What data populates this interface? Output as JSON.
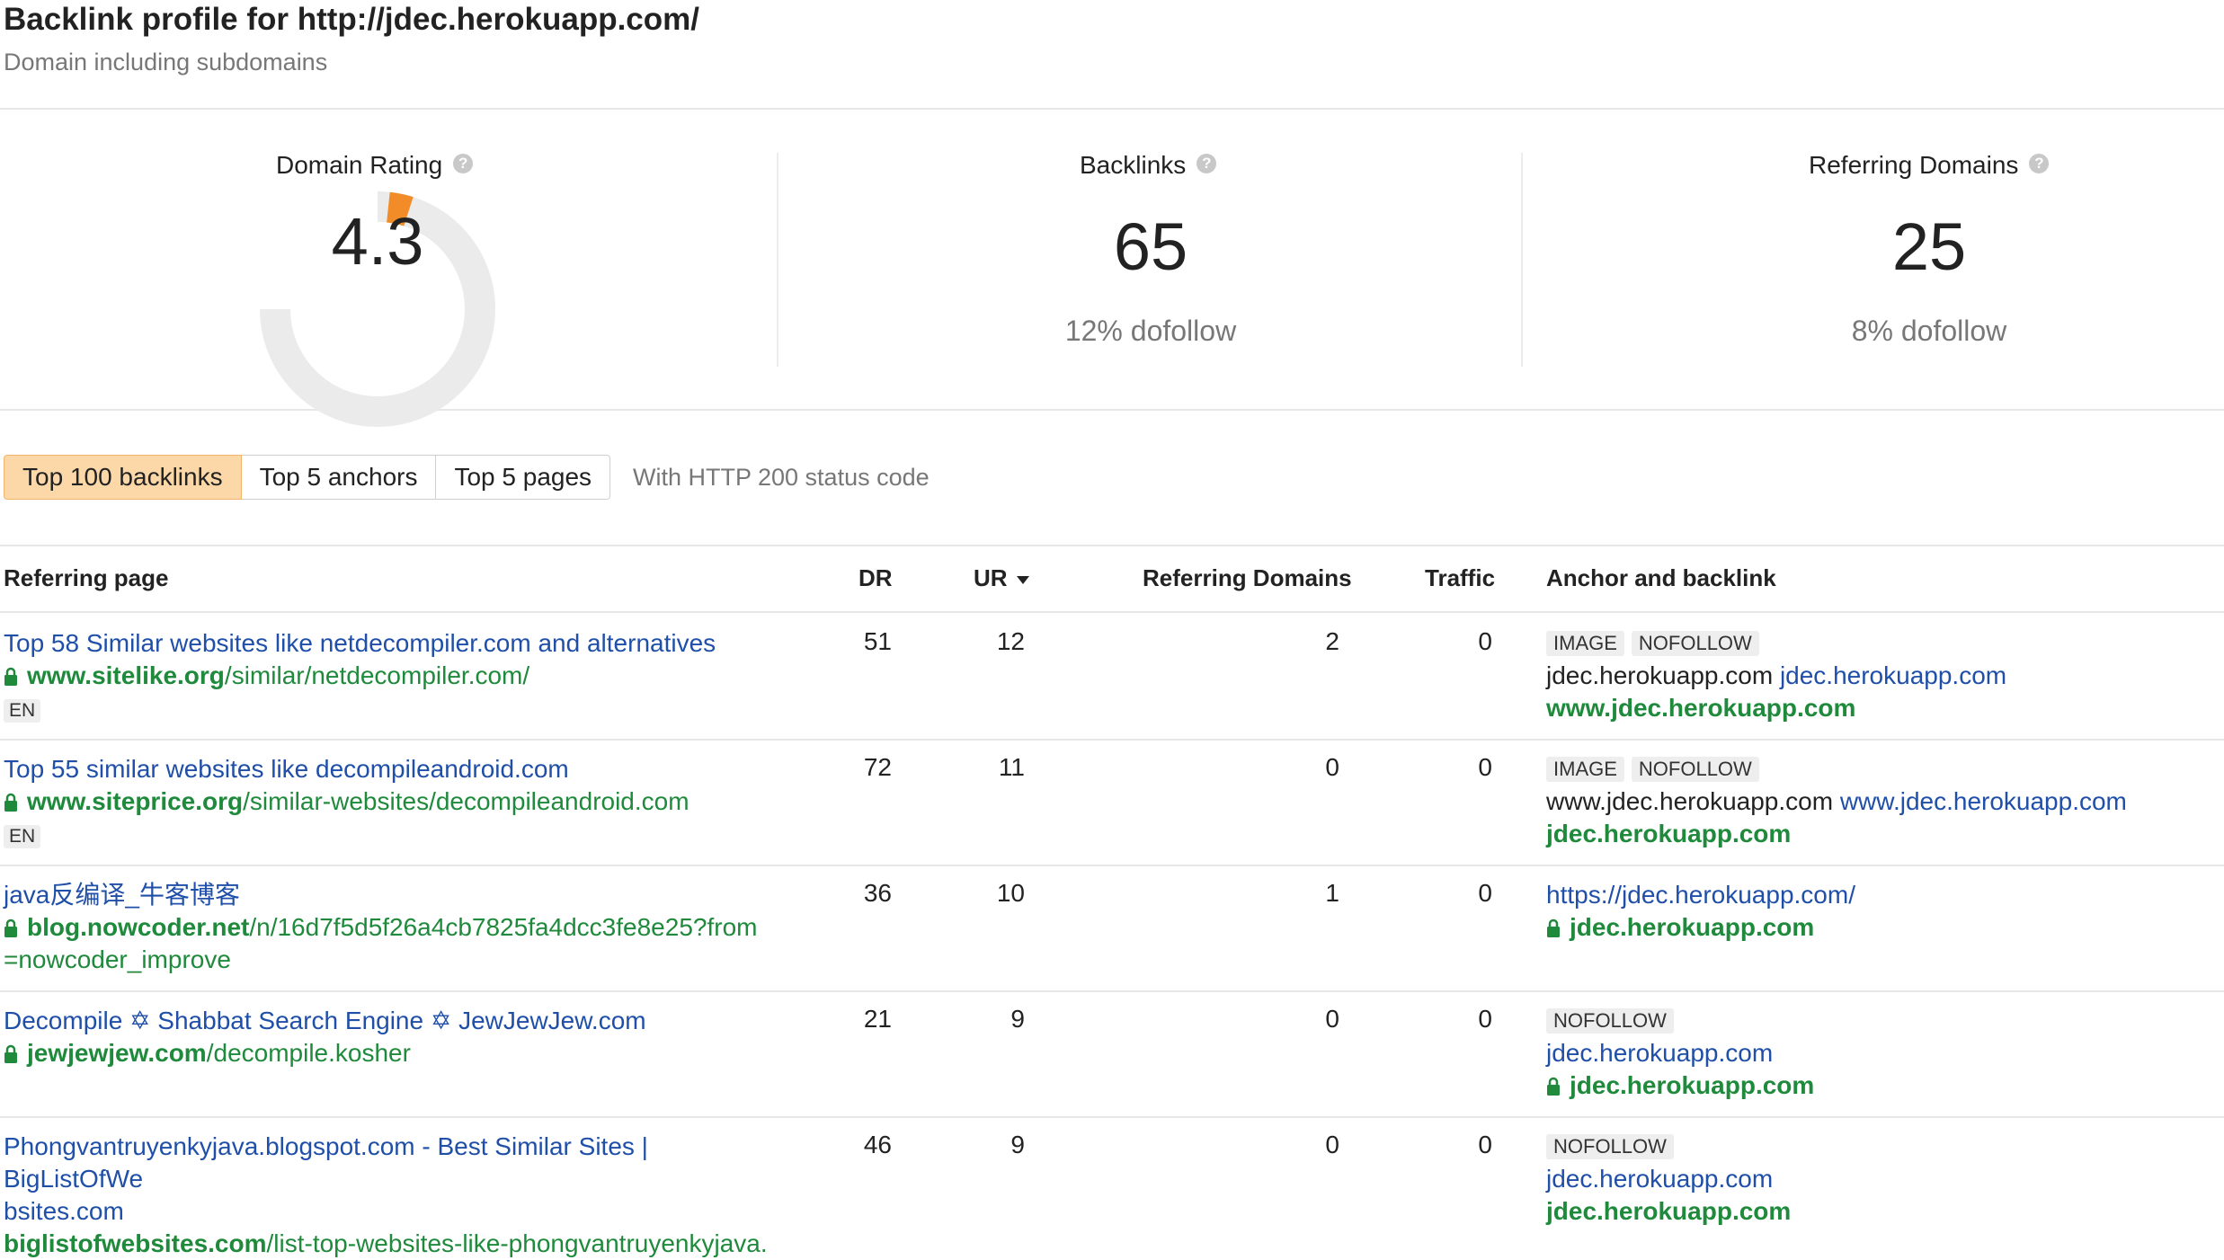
{
  "header": {
    "title": "Backlink profile for http://jdec.herokuapp.com/",
    "subtitle": "Domain including subdomains"
  },
  "metrics": {
    "domain_rating": {
      "label": "Domain Rating",
      "value": "4.3",
      "gauge_fraction": 0.043,
      "accent": "#f28c28"
    },
    "backlinks": {
      "label": "Backlinks",
      "value": "65",
      "sub": "12% dofollow"
    },
    "referring_domains": {
      "label": "Referring Domains",
      "value": "25",
      "sub": "8% dofollow"
    },
    "help_icon": "question-circle-icon"
  },
  "tabs": {
    "items": [
      "Top 100 backlinks",
      "Top 5 anchors",
      "Top 5 pages"
    ],
    "active_index": 0,
    "note": "With HTTP 200 status code"
  },
  "table": {
    "columns": {
      "page": "Referring page",
      "dr": "DR",
      "ur": "UR",
      "rd": "Referring Domains",
      "traffic": "Traffic",
      "anchor": "Anchor and backlink"
    },
    "sort_icon": "caret-down-icon",
    "rows": [
      {
        "title": "Top 58 Similar websites like netdecompiler.com and alternatives",
        "url_domain": "www.sitelike.org",
        "url_path": "/similar/netdecompiler.com/",
        "secure": true,
        "lang": "EN",
        "dr": "51",
        "ur": "12",
        "rd": "2",
        "traffic": "0",
        "badges": [
          "IMAGE",
          "NOFOLLOW"
        ],
        "anchor_text": "jdec.herokuapp.com",
        "anchor_link": "jdec.herokuapp.com",
        "target": "www.jdec.herokuapp.com",
        "target_secure": false
      },
      {
        "title": "Top 55 similar websites like decompileandroid.com",
        "url_domain": "www.siteprice.org",
        "url_path": "/similar-websites/decompileandroid.com",
        "secure": true,
        "lang": "EN",
        "dr": "72",
        "ur": "11",
        "rd": "0",
        "traffic": "0",
        "badges": [
          "IMAGE",
          "NOFOLLOW"
        ],
        "anchor_text": "www.jdec.herokuapp.com",
        "anchor_link": "www.jdec.herokuapp.com",
        "target": "jdec.herokuapp.com",
        "target_secure": false
      },
      {
        "title": "java反编译_牛客博客",
        "url_domain": "blog.nowcoder.net",
        "url_path": "/n/16d7f5d5f26a4cb7825fa4dcc3fe8e25?from",
        "url_path2": "=nowcoder_improve",
        "secure": true,
        "lang": "",
        "dr": "36",
        "ur": "10",
        "rd": "1",
        "traffic": "0",
        "badges": [],
        "anchor_text": "",
        "anchor_link": "https://jdec.herokuapp.com/",
        "target": "jdec.herokuapp.com",
        "target_secure": true
      },
      {
        "title": "Decompile ✡ Shabbat Search Engine ✡ JewJewJew.com",
        "url_domain": "jewjewjew.com",
        "url_path": "/decompile.kosher",
        "secure": true,
        "lang": "",
        "dr": "21",
        "ur": "9",
        "rd": "0",
        "traffic": "0",
        "badges": [
          "NOFOLLOW"
        ],
        "anchor_text": "",
        "anchor_link": "jdec.herokuapp.com",
        "target": "jdec.herokuapp.com",
        "target_secure": true
      },
      {
        "title": "Phongvantruyenkyjava.blogspot.com - Best Similar Sites | BigListOfWe",
        "title2": "bsites.com",
        "url_domain": "biglistofwebsites.com",
        "url_path": "/list-top-websites-like-phongvantruyenkyjava.",
        "secure": false,
        "lang": "",
        "dr": "46",
        "ur": "9",
        "rd": "0",
        "traffic": "0",
        "badges": [
          "NOFOLLOW"
        ],
        "anchor_text": "",
        "anchor_link": "jdec.herokuapp.com",
        "target": "jdec.herokuapp.com",
        "target_secure": false
      }
    ]
  }
}
